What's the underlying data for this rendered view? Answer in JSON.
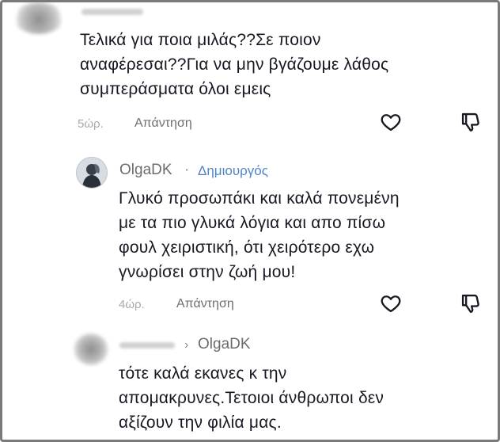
{
  "comments": [
    {
      "text": "Τελικά για ποια μιλάς??Σε ποιον\nαναφέρεσαι??Για να μην βγάζουμε λάθος\nσυμπεράσματα όλοι εμεις",
      "time": "5ώρ.",
      "reply_label": "Απάντηση"
    },
    {
      "username": "OlgaDK",
      "separator": "·",
      "badge": "Δημιουργός",
      "text": "Γλυκό προσωπάκι και καλά πονεμένη\nμε τα πιο γλυκά λόγια και απο πίσω\nφουλ χειριστική, ότι χειρότερο εχω\nγνωρίσει στην ζωή μου!",
      "time": "4ώρ.",
      "reply_label": "Απάντηση"
    },
    {
      "reply_to": "OlgaDK",
      "text": "τότε καλά εκανες κ την\nαπομακρυνες.Τετοιοι άνθρωποι δεν\nαξίζουν την φιλία μας."
    }
  ],
  "icons": {
    "like": "heart-outline-icon",
    "dislike": "thumbs-down-outline-icon",
    "reply_arrow": "chevron-right-icon"
  },
  "colors": {
    "text": "#161823",
    "meta": "#a8a8a8",
    "creator_badge": "#4f86c6",
    "icon": "#161823"
  }
}
